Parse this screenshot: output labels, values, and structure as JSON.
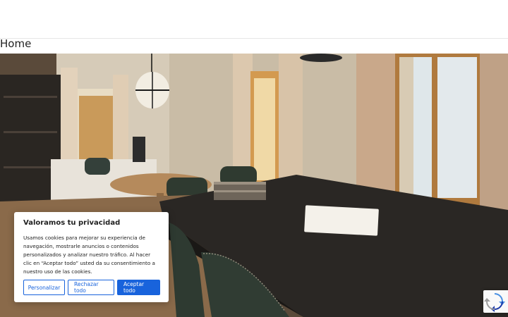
{
  "page": {
    "title": "Home"
  },
  "cookie_banner": {
    "title": "Valoramos tu privacidad",
    "body": "Usamos cookies para mejorar su experiencia de navegación, mostrarle anuncios o contenidos personalizados y analizar nuestro tráfico. Al hacer clic en “Aceptar todo” usted da su consentimiento a nuestro uso de las cookies.",
    "customize_label": "Personalizar",
    "reject_label": "Rechazar todo",
    "accept_label": "Aceptar todo"
  },
  "colors": {
    "accent": "#1863dc"
  },
  "widgets": {
    "recaptcha_icon": "recaptcha-icon"
  }
}
